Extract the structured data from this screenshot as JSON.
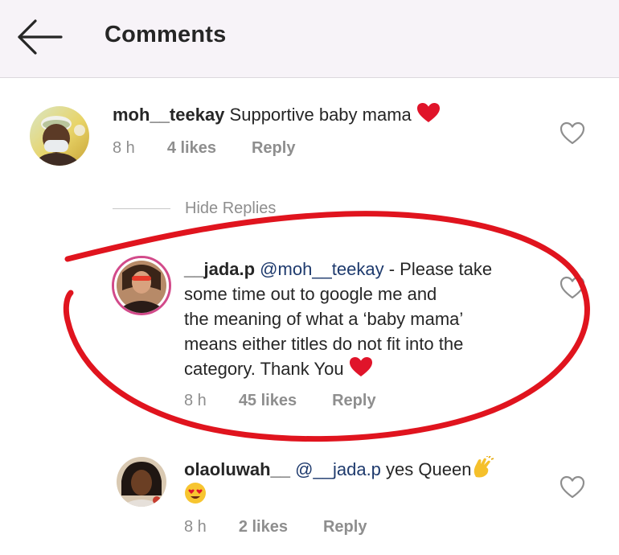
{
  "header": {
    "title": "Comments",
    "back_icon": "arrow-left-icon"
  },
  "comments": [
    {
      "username": "moh__teekay",
      "mention": "",
      "text": "Supportive baby mama",
      "time": "8 h",
      "likes": "4 likes",
      "reply_label": "Reply"
    },
    {
      "username": "__jada.p",
      "mention": "@moh__teekay",
      "text_line1": " - Please take",
      "text_line2": "some time  out to google me and",
      "text_line3": "the meaning of what a ‘baby mama’",
      "text_line4": "means either titles do not fit into the",
      "text_line5": "category. Thank You",
      "time": "8 h",
      "likes": "45 likes",
      "reply_label": "Reply"
    },
    {
      "username": "olaoluwah__",
      "mention": "@__jada.p",
      "text": " yes Queen",
      "time": "8 h",
      "likes": "2 likes",
      "reply_label": "Reply"
    }
  ],
  "thread": {
    "hide_replies_label": "Hide Replies"
  },
  "colors": {
    "header_bg": "#f7f3f8",
    "mention": "#1e3a6d",
    "meta": "#8e8e8e",
    "heart": "#e0142a",
    "annotation": "#e0141e"
  }
}
